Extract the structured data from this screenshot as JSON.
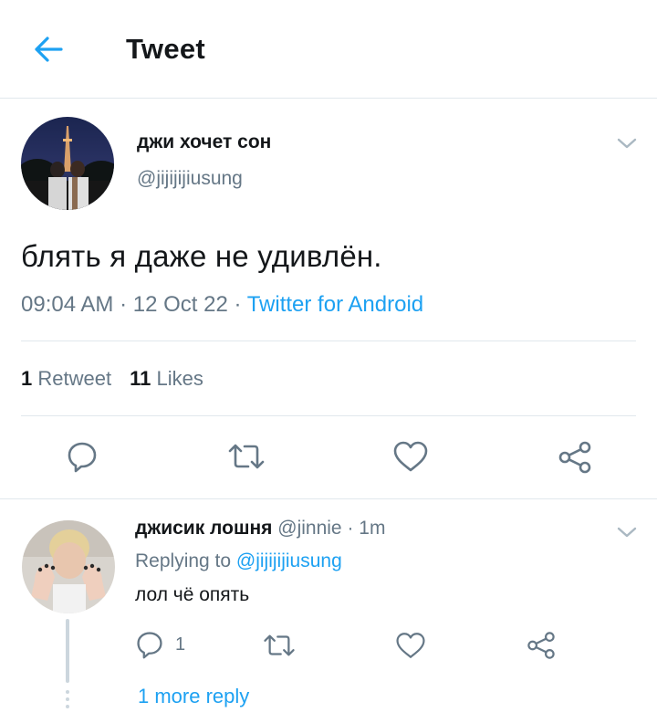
{
  "header": {
    "title": "Tweet"
  },
  "tweet": {
    "author_name": "джи хочет сон",
    "author_handle": "@jijijijiusung",
    "text": "блять я даже не удивлён.",
    "time": "09:04 AM",
    "sep1": " · ",
    "date": "12 Oct 22",
    "sep2": " · ",
    "source": "Twitter for Android",
    "retweet_count": "1",
    "retweet_label": "Retweet",
    "likes_count": "11",
    "likes_label": "Likes"
  },
  "reply": {
    "author_name": "джисик лошня",
    "author_handle": "@jinnie",
    "time_sep": " · ",
    "time": "1m",
    "replying_prefix": "Replying to ",
    "replying_to": "@jijijijiusung",
    "text": "лол чё опять",
    "reply_count": "1",
    "more_replies": "1 more reply"
  },
  "colors": {
    "accent": "#1da1f2",
    "muted": "#657786",
    "divider": "#e1e8ed",
    "text": "#14171a"
  },
  "icons": [
    "back-arrow-icon",
    "chevron-down-icon",
    "reply-icon",
    "retweet-icon",
    "like-icon",
    "share-icon"
  ]
}
